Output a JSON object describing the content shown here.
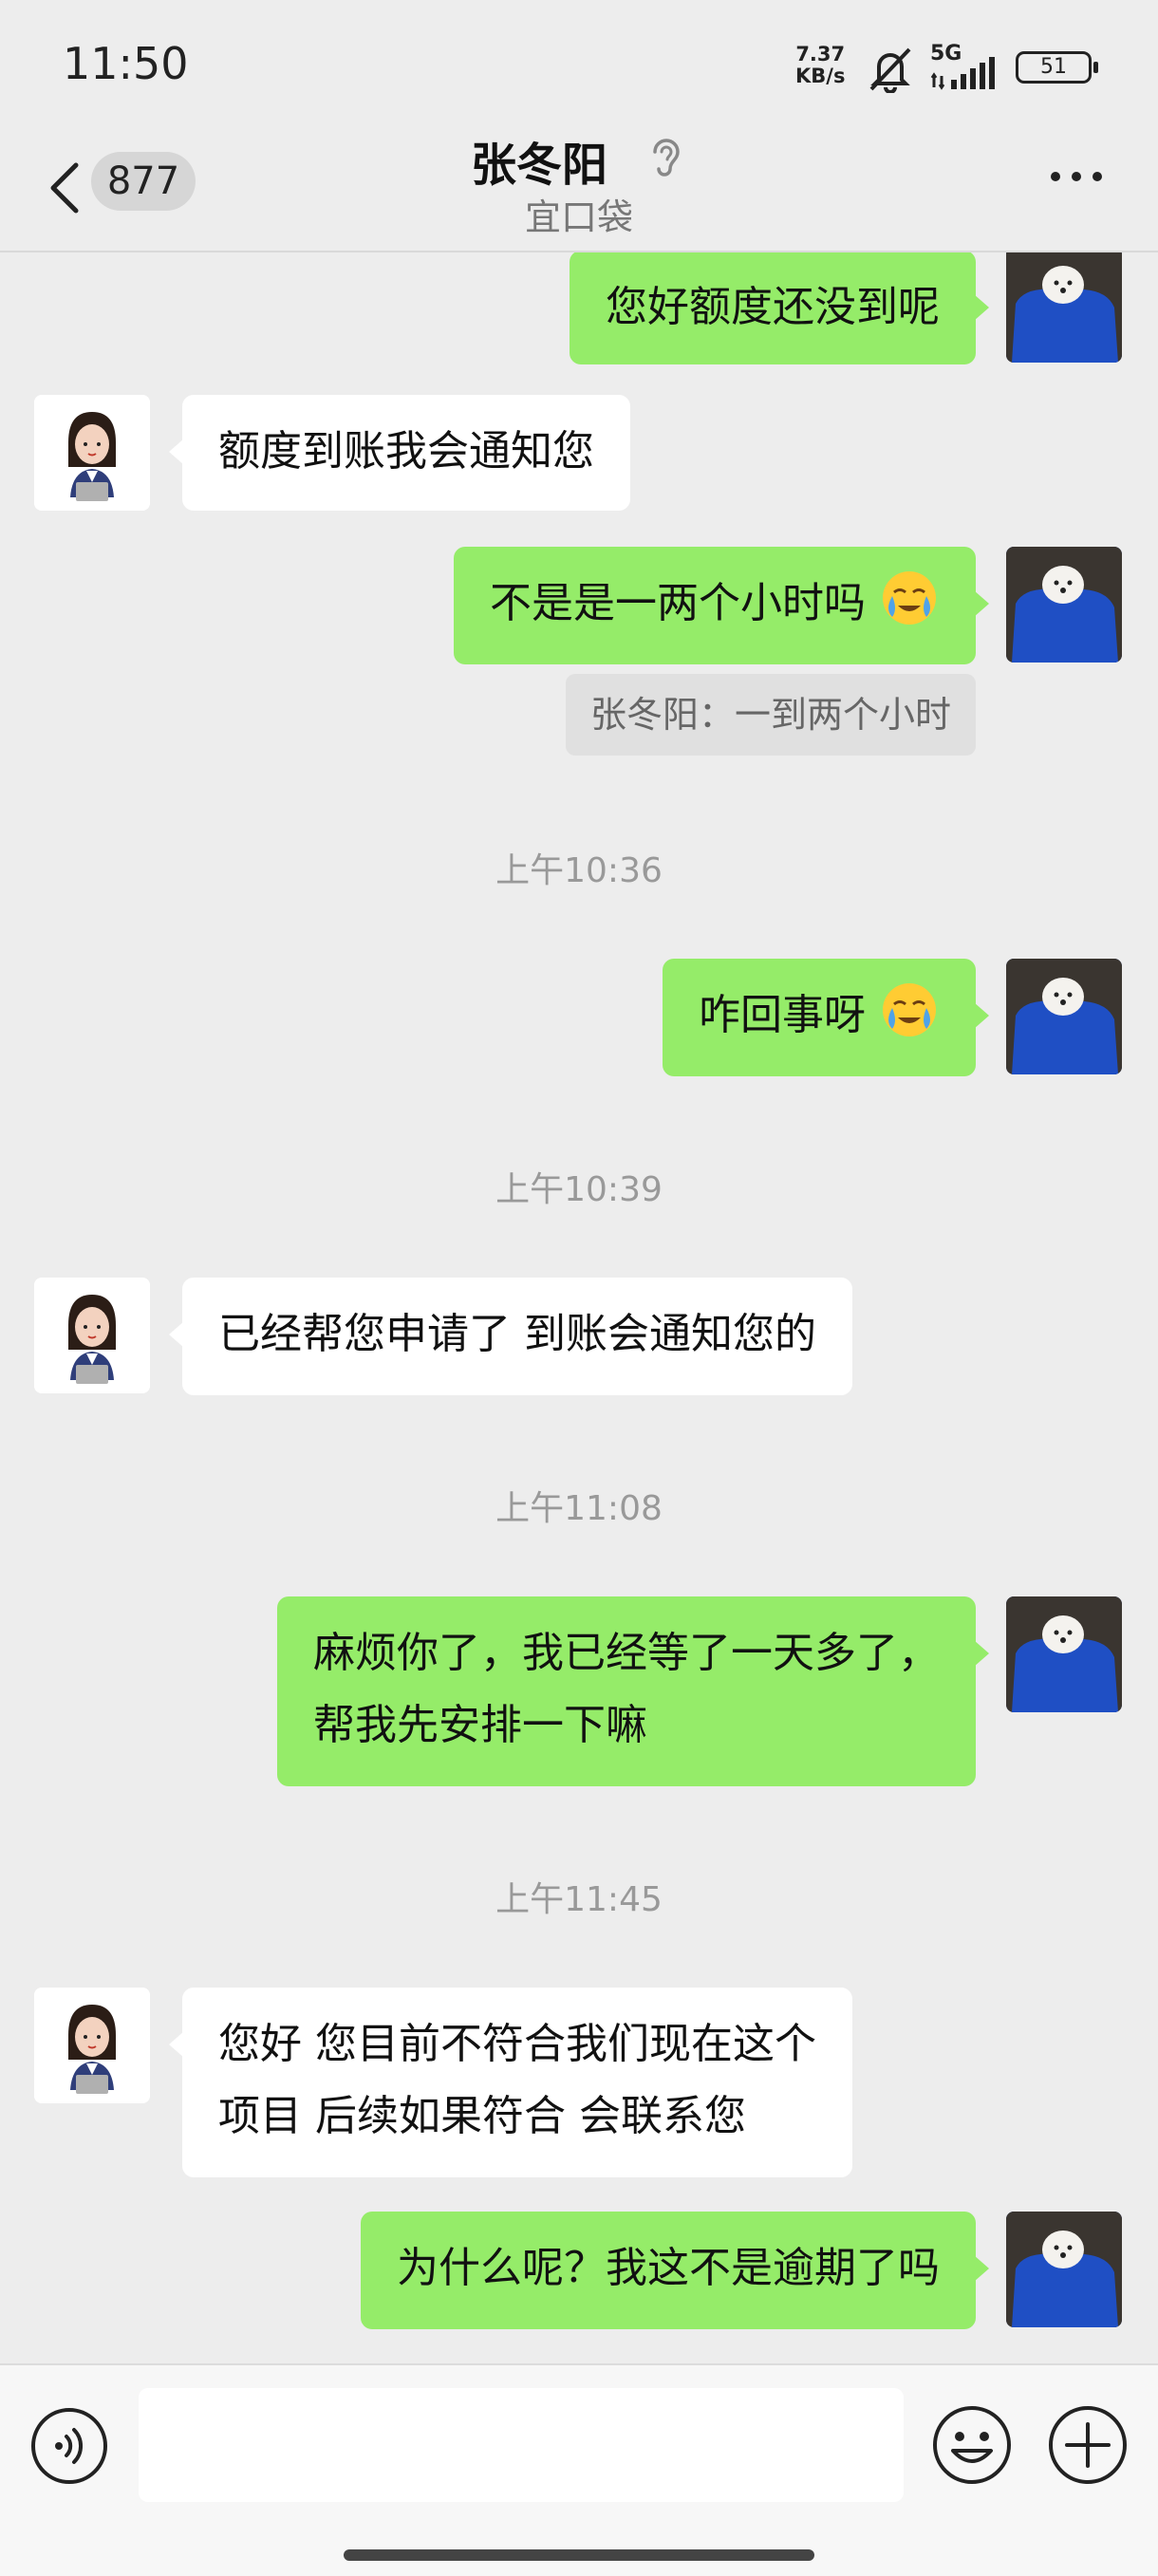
{
  "status_bar": {
    "time": "11:50",
    "net_speed_value": "7.37",
    "net_speed_unit": "KB/s",
    "network": "5G",
    "battery": "51",
    "icons": [
      "mute-bell-icon",
      "signal-icon",
      "battery-icon"
    ]
  },
  "header": {
    "unread_count": "877",
    "contact_name": "张冬阳",
    "subtitle": "宜口袋",
    "icons": [
      "back-chevron-icon",
      "ear-icon",
      "more-dots-icon"
    ]
  },
  "messages": {
    "m1": "您好额度还没到呢",
    "m2": "额度到账我会通知您",
    "m3": "不是是一两个小时吗",
    "m3_quote": "张冬阳：一到两个小时",
    "t1": "上午10:36",
    "m4": "咋回事呀",
    "t2": "上午10:39",
    "m5": "已经帮您申请了 到账会通知您的",
    "t3": "上午11:08",
    "m6_line1": "麻烦你了，我已经等了一天多了，",
    "m6_line2": "帮我先安排一下嘛",
    "t4": "上午11:45",
    "m7_line1": "您好 您目前不符合我们现在这个",
    "m7_line2": "项目  后续如果符合 会联系您",
    "m8": "为什么呢？我这不是逾期了吗"
  },
  "input_bar": {
    "text_value": "",
    "icons": [
      "voice-icon",
      "emoji-icon",
      "plus-icon"
    ]
  },
  "colors": {
    "my_bubble": "#95ec69",
    "their_bubble": "#ffffff",
    "background": "#ededed",
    "my_avatar": "#2d4fa8"
  }
}
